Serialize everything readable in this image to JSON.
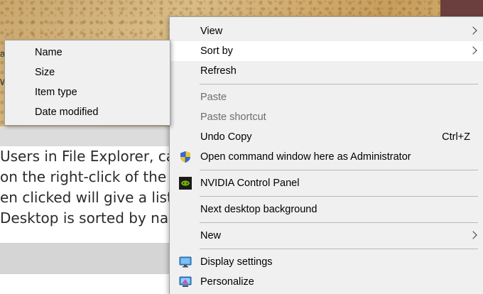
{
  "background": {
    "article_lines": [
      "Users in File Explorer, ca",
      "on the right-click of the T",
      "en clicked will give a list",
      " Desktop is sorted by na"
    ],
    "edge_chars": [
      "a",
      "W"
    ]
  },
  "context_menu": {
    "items": [
      {
        "label": "View",
        "submenu": true
      },
      {
        "label": "Sort by",
        "submenu": true
      },
      {
        "label": "Refresh"
      },
      {
        "label": "Paste",
        "disabled": true
      },
      {
        "label": "Paste shortcut",
        "disabled": true
      },
      {
        "label": "Undo Copy",
        "shortcut": "Ctrl+Z"
      },
      {
        "label": "Open command window here as Administrator",
        "icon": "uac-shield-icon"
      },
      {
        "label": "NVIDIA Control Panel",
        "icon": "nvidia-icon"
      },
      {
        "label": "Next desktop background"
      },
      {
        "label": "New",
        "submenu": true
      },
      {
        "label": "Display settings",
        "icon": "display-icon"
      },
      {
        "label": "Personalize",
        "icon": "personalize-icon"
      }
    ]
  },
  "sort_by_submenu": {
    "items": [
      {
        "label": "Name"
      },
      {
        "label": "Size"
      },
      {
        "label": "Item type"
      },
      {
        "label": "Date modified"
      }
    ]
  },
  "colors": {
    "menu_bg": "#f0f0f0",
    "hover_bg": "#ffffff",
    "disabled_text": "#6d6d6d",
    "nvidia_green": "#76b900"
  }
}
